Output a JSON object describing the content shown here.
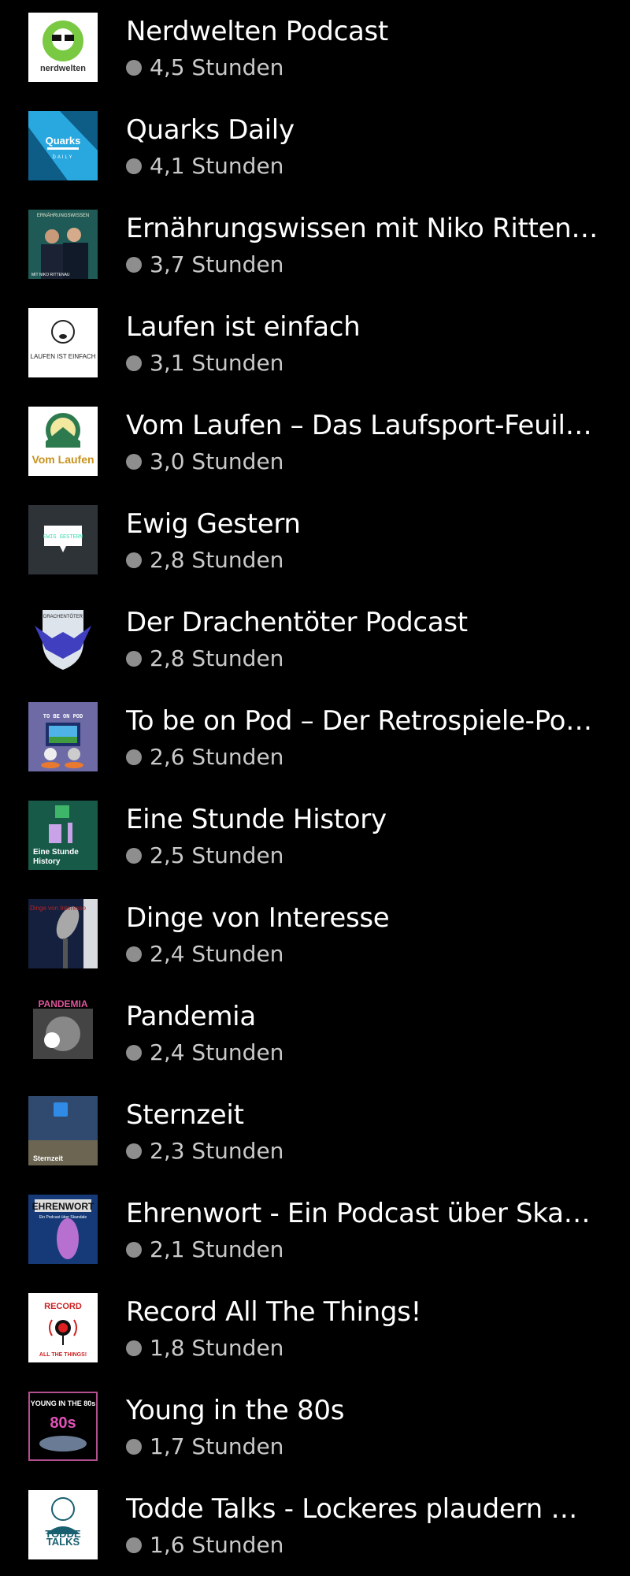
{
  "podcasts": [
    {
      "title": "Nerdwelten Podcast",
      "duration": "4,5 Stunden",
      "art": "nerdwelten",
      "art_text": "nerdwelten"
    },
    {
      "title": "Quarks Daily",
      "duration": "4,1 Stunden",
      "art": "quarks",
      "art_text": "Quarks",
      "art_subtext": "DAILY"
    },
    {
      "title": "Ernährungswissen mit Niko Rittenau",
      "duration": "3,7 Stunden",
      "art": "ernaehrung",
      "art_text": "ERNÄHRUNGSWISSEN",
      "art_subtext": "MIT NIKO RITTENAU"
    },
    {
      "title": "Laufen ist einfach",
      "duration": "3,1 Stunden",
      "art": "laufen",
      "art_text": "LAUFEN IST EINFACH"
    },
    {
      "title": "Vom Laufen – Das Laufsport-Feuillet...",
      "duration": "3,0 Stunden",
      "art": "vomlaufen",
      "art_text": "Vom Laufen"
    },
    {
      "title": "Ewig Gestern",
      "duration": "2,8 Stunden",
      "art": "ewig",
      "art_text": "EWIG GESTERN"
    },
    {
      "title": "Der Drachentöter Podcast",
      "duration": "2,8 Stunden",
      "art": "drachen",
      "art_text": "DRACHENTÖTER"
    },
    {
      "title": "To be on Pod – Der Retrospiele-Podc...",
      "duration": "2,6 Stunden",
      "art": "tobeonpod",
      "art_text": "TO BE ON POD"
    },
    {
      "title": "Eine Stunde History",
      "duration": "2,5 Stunden",
      "art": "history",
      "art_text": "Eine Stunde",
      "art_subtext": "History"
    },
    {
      "title": "Dinge von Interesse",
      "duration": "2,4 Stunden",
      "art": "dinge",
      "art_text": "Dinge von Interesse"
    },
    {
      "title": "Pandemia",
      "duration": "2,4 Stunden",
      "art": "pandemia",
      "art_text": "PANDEMIA"
    },
    {
      "title": "Sternzeit",
      "duration": "2,3 Stunden",
      "art": "sternzeit",
      "art_text": "Sternzeit"
    },
    {
      "title": "Ehrenwort - Ein Podcast über Skand...",
      "duration": "2,1 Stunden",
      "art": "ehrenwort",
      "art_text": "EHRENWORT",
      "art_subtext": "Ein Podcast über Skandale"
    },
    {
      "title": "Record All The Things!",
      "duration": "1,8 Stunden",
      "art": "record",
      "art_text": "RECORD",
      "art_subtext": "ALL THE THINGS!"
    },
    {
      "title": "Young in the 80s",
      "duration": "1,7 Stunden",
      "art": "young80s",
      "art_text": "YOUNG IN THE 80s"
    },
    {
      "title": "Todde Talks - Lockeres plaudern mit...",
      "duration": "1,6 Stunden",
      "art": "todde",
      "art_text": "TODDE",
      "art_subtext": "TALKS"
    }
  ]
}
